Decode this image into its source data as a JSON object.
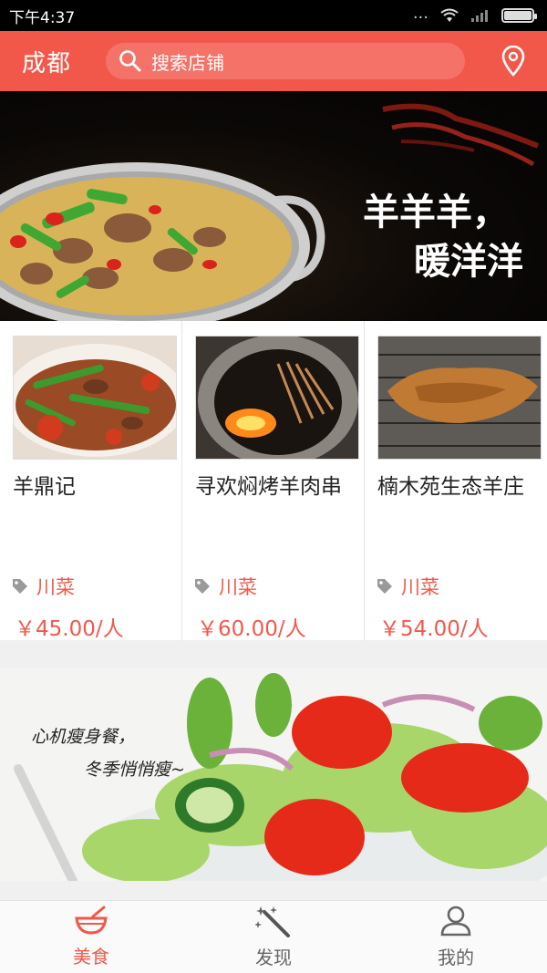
{
  "status_bar": {
    "time": "下午4:37",
    "dots": "..."
  },
  "header": {
    "city": "成都",
    "search_placeholder": "搜索店铺"
  },
  "banner": {
    "line1": "羊羊羊，",
    "line2": "暖洋洋"
  },
  "restaurants": [
    {
      "name": "羊鼎记",
      "tag": "川菜",
      "price": "￥45.00/人"
    },
    {
      "name": "寻欢焖烤羊肉串",
      "tag": "川菜",
      "price": "￥60.00/人"
    },
    {
      "name": "楠木苑生态羊庄",
      "tag": "川菜",
      "price": "￥54.00/人"
    }
  ],
  "promo": {
    "line1": "心机瘦身餐，",
    "line2": "冬季悄悄瘦~"
  },
  "nav": [
    {
      "label": "美食",
      "icon": "bowl-icon",
      "active": true
    },
    {
      "label": "发现",
      "icon": "magic-wand-icon",
      "active": false
    },
    {
      "label": "我的",
      "icon": "user-icon",
      "active": false
    }
  ],
  "colors": {
    "accent": "#f2584a"
  }
}
